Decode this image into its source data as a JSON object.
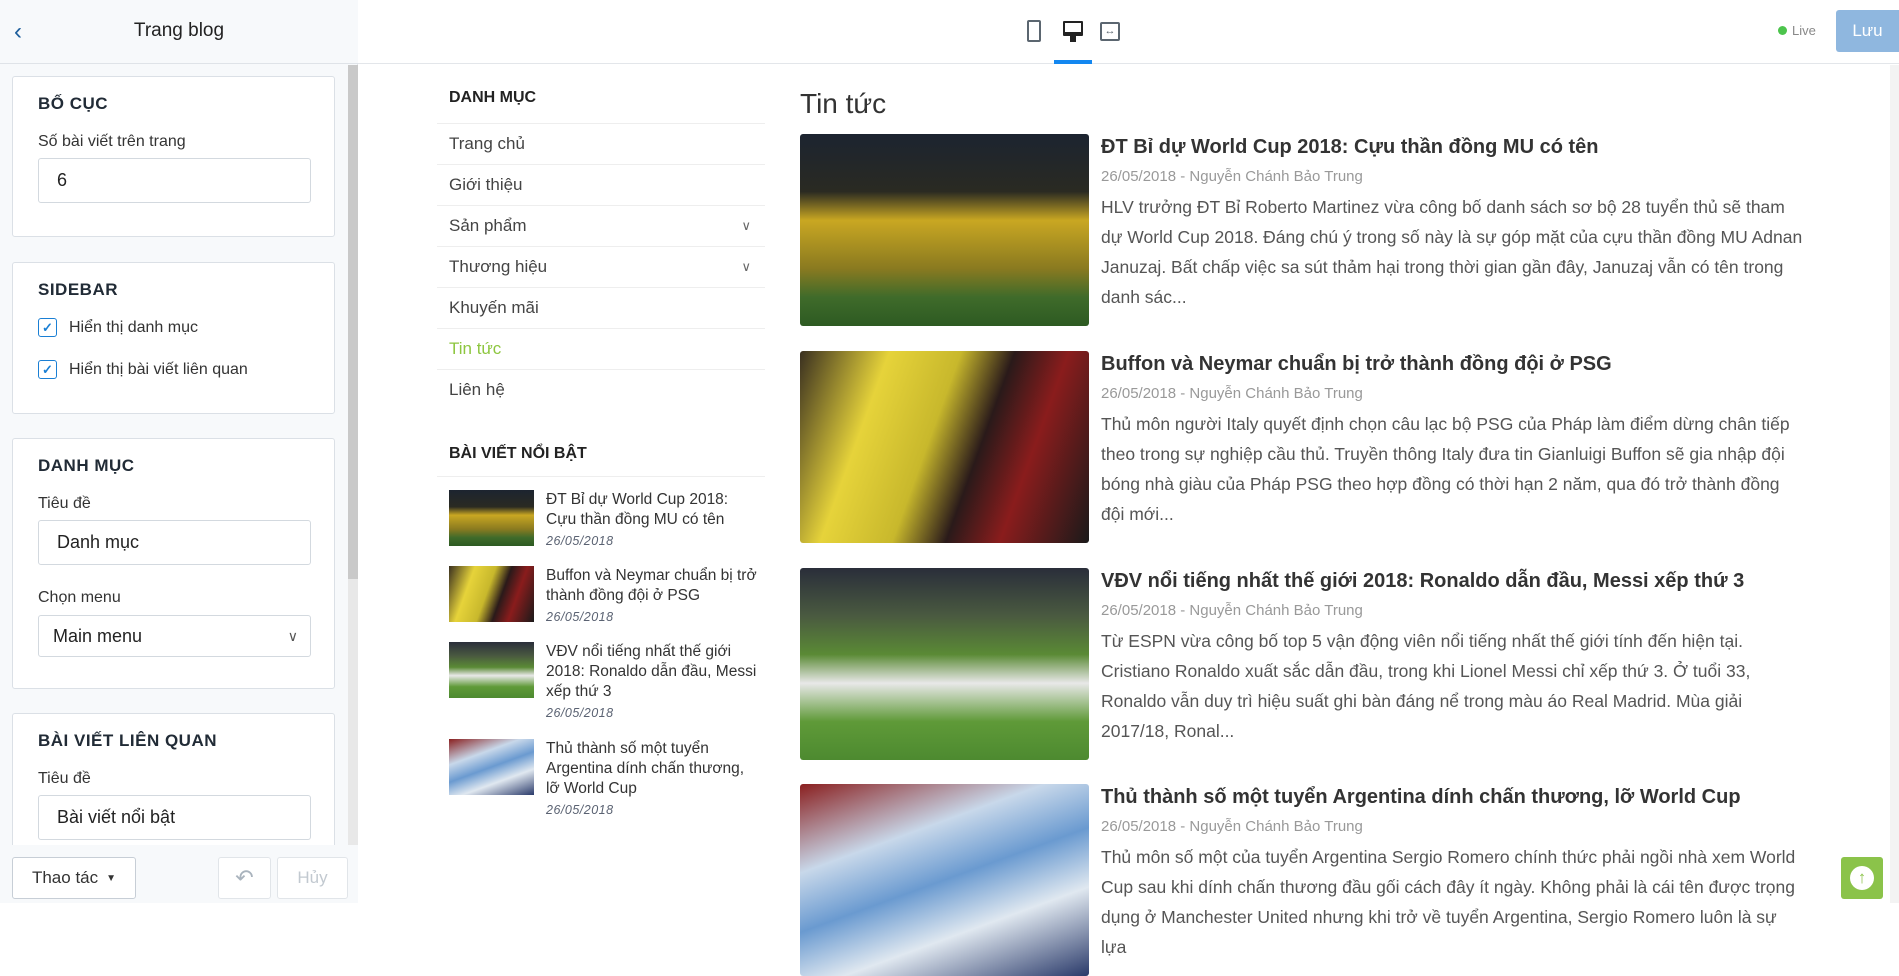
{
  "editor": {
    "title": "Trang blog",
    "back_icon": "chevron-left-icon"
  },
  "sections": {
    "layout": {
      "title": "BỐ CỤC",
      "posts_per_page_label": "Số bài viết trên trang",
      "posts_per_page_value": "6"
    },
    "sidebar": {
      "title": "SIDEBAR",
      "show_categories": {
        "label": "Hiển thị danh mục",
        "checked": true
      },
      "show_related": {
        "label": "Hiển thị bài viết liên quan",
        "checked": true
      }
    },
    "categories": {
      "title": "DANH MỤC",
      "title_label": "Tiêu đề",
      "title_value": "Danh mục",
      "menu_label": "Chọn menu",
      "menu_value": "Main menu"
    },
    "related": {
      "title": "BÀI VIẾT LIÊN QUAN",
      "title_label": "Tiêu đề",
      "title_value": "Bài viết nổi bật"
    }
  },
  "footer": {
    "actions_label": "Thao tác",
    "cancel_label": "Hủy"
  },
  "topbar": {
    "live_label": "Live",
    "save_label": "Lưu",
    "accent": "#1387f0"
  },
  "preview": {
    "categories_heading": "DANH MỤC",
    "menu": [
      {
        "label": "Trang chủ"
      },
      {
        "label": "Giới thiệu"
      },
      {
        "label": "Sản phẩm",
        "has_children": true
      },
      {
        "label": "Thương hiệu",
        "has_children": true
      },
      {
        "label": "Khuyến mãi"
      },
      {
        "label": "Tin tức",
        "active": true
      },
      {
        "label": "Liên hệ"
      }
    ],
    "active_color": "#8dc63f",
    "featured_heading": "BÀI VIẾT NỔI BẬT",
    "featured": [
      {
        "title": "ĐT Bỉ dự World Cup 2018: Cựu thần đồng MU có tên",
        "date": "26/05/2018"
      },
      {
        "title": "Buffon và Neymar chuẩn bị trở thành đồng đội ở PSG",
        "date": "26/05/2018"
      },
      {
        "title": "VĐV nổi tiếng nhất thế giới 2018: Ronaldo dẫn đầu, Messi xếp thứ 3",
        "date": "26/05/2018"
      },
      {
        "title": "Thủ thành số một tuyển Argentina dính chấn thương, lỡ World Cup",
        "date": "26/05/2018"
      }
    ],
    "page_title": "Tin tức",
    "posts": [
      {
        "title": "ĐT Bỉ dự World Cup 2018: Cựu thần đồng MU có tên",
        "meta": "26/05/2018 - Nguyễn Chánh Bảo Trung",
        "excerpt": "HLV trưởng ĐT Bỉ Roberto Martinez vừa công bố danh sách sơ bộ 28 tuyển thủ sẽ tham dự World Cup 2018. Đáng chú ý trong số này là sự góp mặt của cựu thần đồng MU Adnan Januzaj. Bất chấp việc sa sút thảm hại trong thời gian gần đây, Januzaj vẫn có tên trong danh sác..."
      },
      {
        "title": "Buffon và Neymar chuẩn bị trở thành đồng đội ở PSG",
        "meta": "26/05/2018 - Nguyễn Chánh Bảo Trung",
        "excerpt": "Thủ môn người Italy quyết định chọn câu lạc bộ PSG của Pháp làm điểm dừng chân tiếp theo trong sự nghiệp cầu thủ. Truyền thông Italy đưa tin Gianluigi Buffon sẽ gia nhập đội bóng nhà giàu của Pháp PSG theo hợp đồng có thời hạn 2 năm, qua đó trở thành đồng đội mới..."
      },
      {
        "title": "VĐV nổi tiếng nhất thế giới 2018: Ronaldo dẫn đầu, Messi xếp thứ 3",
        "meta": "26/05/2018 - Nguyễn Chánh Bảo Trung",
        "excerpt": "Từ ESPN vừa công bố top 5 vận động viên nổi tiếng nhất thế giới tính đến hiện tại. Cristiano Ronaldo xuất sắc dẫn đầu, trong khi Lionel Messi chỉ xếp thứ 3. Ở tuổi 33, Ronaldo vẫn duy trì hiệu suất ghi bàn đáng nể trong màu áo Real Madrid. Mùa giải 2017/18, Ronal..."
      },
      {
        "title": "Thủ thành số một tuyển Argentina dính chấn thương, lỡ World Cup",
        "meta": "26/05/2018 - Nguyễn Chánh Bảo Trung",
        "excerpt": "Thủ môn số một của tuyển Argentina Sergio Romero chính thức phải ngồi nhà xem World Cup sau khi dính chấn thương đầu gối cách đây ít ngày. Không phải là cái tên được trọng dụng ở Manchester United nhưng khi trở về tuyển Argentina, Sergio Romero luôn là sự lựa"
      }
    ]
  }
}
